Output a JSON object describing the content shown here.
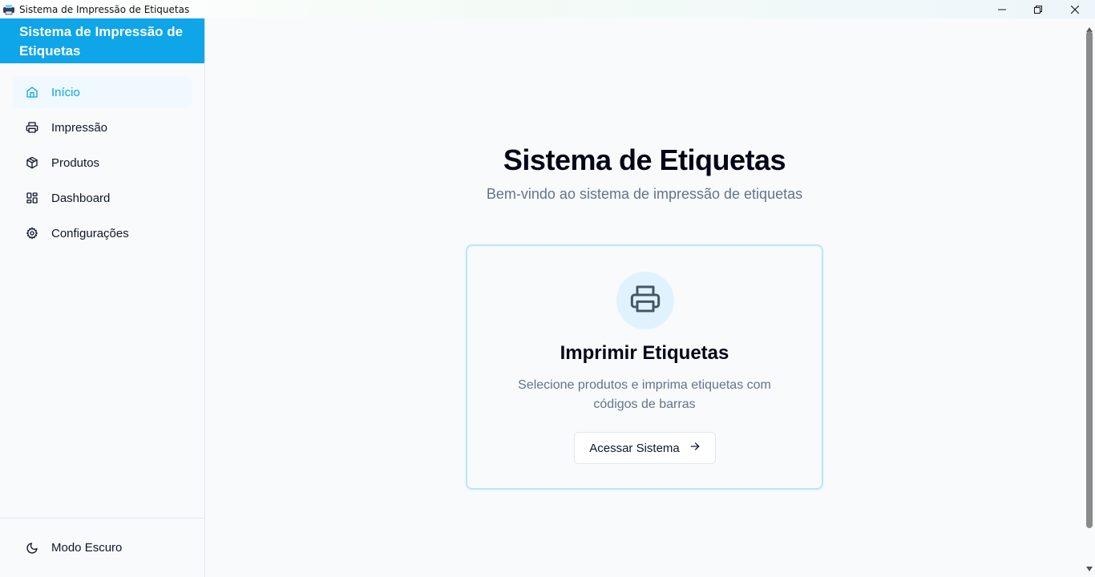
{
  "window": {
    "title": "Sistema de Impressão de Etiquetas"
  },
  "sidebar": {
    "brand": "Sistema de Impressão de Etiquetas",
    "items": [
      {
        "label": "Início",
        "icon": "home-icon",
        "active": true
      },
      {
        "label": "Impressão",
        "icon": "printer-icon",
        "active": false
      },
      {
        "label": "Produtos",
        "icon": "package-icon",
        "active": false
      },
      {
        "label": "Dashboard",
        "icon": "dashboard-icon",
        "active": false
      },
      {
        "label": "Configurações",
        "icon": "gear-icon",
        "active": false
      }
    ],
    "footer_label": "Modo Escuro",
    "footer_icon": "moon-icon"
  },
  "main": {
    "title": "Sistema de Etiquetas",
    "subtitle": "Bem-vindo ao sistema de impressão de etiquetas",
    "card": {
      "icon": "printer-icon",
      "title": "Imprimir Etiquetas",
      "description": "Selecione produtos e imprima etiquetas com códigos de barras",
      "button_label": "Acessar Sistema"
    }
  },
  "colors": {
    "accent": "#0ea5e9",
    "active_bg": "#f0f9ff",
    "card_border": "#bae6fd",
    "muted_text": "#64748b"
  }
}
